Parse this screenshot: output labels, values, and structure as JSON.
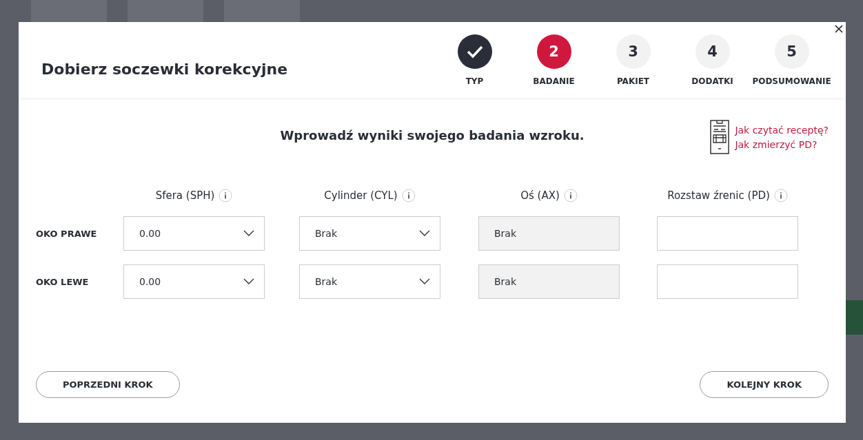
{
  "dialog": {
    "title": "Dobierz soczewki korekcyjne",
    "steps": [
      {
        "label": "TYP",
        "completed": true,
        "selected": false
      },
      {
        "number": "2",
        "label": "BADANIE",
        "completed": false,
        "selected": true
      },
      {
        "number": "3",
        "label": "PAKIET",
        "completed": false,
        "selected": false
      },
      {
        "number": "4",
        "label": "DODATKI",
        "completed": false,
        "selected": false
      },
      {
        "number": "5",
        "label": "PODSUMOWANIE",
        "completed": false,
        "selected": false
      }
    ],
    "heading": "Wprowadź wyniki swojego badania wzroku.",
    "help_links": [
      "Jak czytać receptę?",
      "Jak zmierzyć PD?"
    ],
    "columns": [
      "Sfera (SPH)",
      "Cylinder (CYL)",
      "Oś (AX)",
      "Rozstaw źrenic (PD)"
    ],
    "rows": [
      {
        "label": "OKO PRAWE",
        "fields": [
          {
            "kind": "select",
            "value": "0.00"
          },
          {
            "kind": "select",
            "value": "Brak"
          },
          {
            "kind": "readonly",
            "value": "Brak"
          },
          {
            "kind": "input"
          }
        ]
      },
      {
        "label": "OKO LEWE",
        "fields": [
          {
            "kind": "select",
            "value": "0.00"
          },
          {
            "kind": "select",
            "value": "Brak"
          },
          {
            "kind": "readonly",
            "value": "Brak"
          },
          {
            "kind": "input"
          }
        ]
      }
    ],
    "back_button": "POPRZEDNI KROK",
    "next_button": "KOLEJNY KROK"
  }
}
